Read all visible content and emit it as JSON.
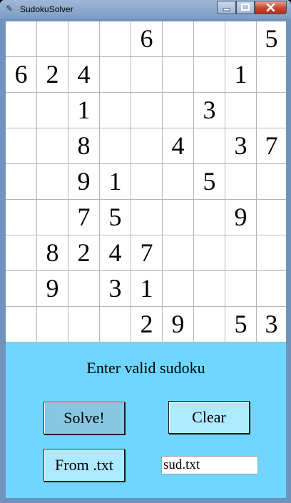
{
  "window": {
    "title": "SudokuSolver",
    "app_icon": "feather-icon"
  },
  "grid": [
    [
      "",
      "",
      "",
      "",
      "6",
      "",
      "",
      "",
      "5"
    ],
    [
      "6",
      "2",
      "4",
      "",
      "",
      "",
      "",
      "1",
      ""
    ],
    [
      "",
      "",
      "1",
      "",
      "",
      "",
      "3",
      "",
      ""
    ],
    [
      "",
      "",
      "8",
      "",
      "",
      "4",
      "",
      "3",
      "7"
    ],
    [
      "",
      "",
      "9",
      "1",
      "",
      "",
      "5",
      "",
      ""
    ],
    [
      "",
      "",
      "7",
      "5",
      "",
      "",
      "",
      "9",
      ""
    ],
    [
      "",
      "8",
      "2",
      "4",
      "7",
      "",
      "",
      "",
      ""
    ],
    [
      "",
      "9",
      "",
      "3",
      "1",
      "",
      "",
      "",
      ""
    ],
    [
      "",
      "",
      "",
      "",
      "2",
      "9",
      "",
      "5",
      "3"
    ]
  ],
  "panel": {
    "status": "Enter valid sudoku",
    "solve_label": "Solve!",
    "clear_label": "Clear",
    "from_file_label": "From .txt",
    "file_name_value": "sud.txt"
  },
  "colors": {
    "panel_bg": "#6ed6ff",
    "solve_button": "#87c7e2",
    "button": "#aeeaff"
  }
}
